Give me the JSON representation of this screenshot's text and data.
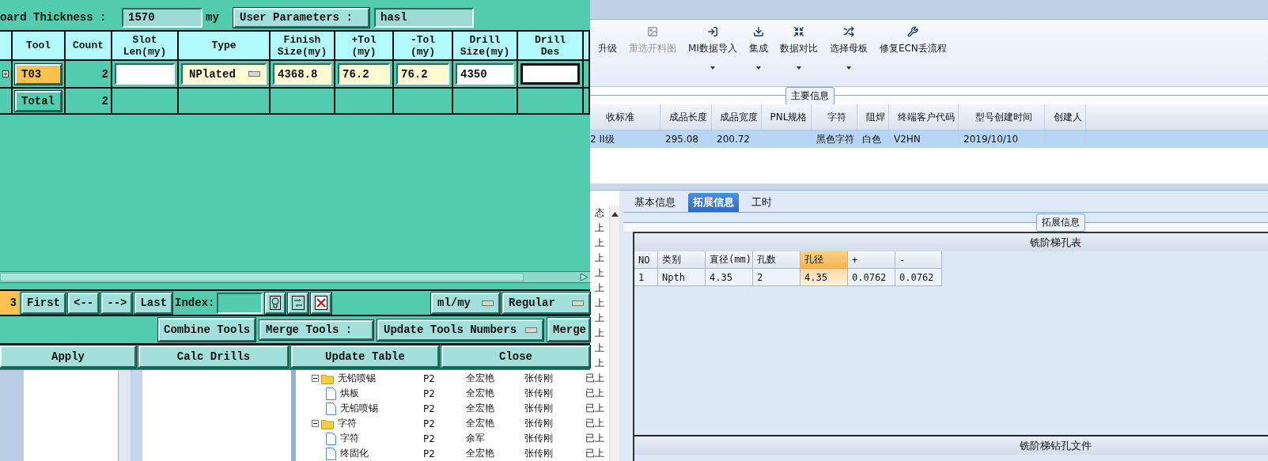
{
  "dialog": {
    "board_thickness": {
      "label": "oard Thickness :",
      "value": "1570",
      "unit": "my"
    },
    "user_parameters": {
      "label": "User Parameters :",
      "value": "hasl"
    },
    "tools_table": {
      "columns": [
        "Tool",
        "Count",
        "Slot Len(my)",
        "Type",
        "Finish Size(my)",
        "+Tol (my)",
        "-Tol (my)",
        "Drill Size(my)",
        "Drill Des"
      ],
      "rows": [
        {
          "tool": "T03",
          "selected": true,
          "count": "2",
          "cells": [
            {
              "kind": "input",
              "highlighted": false,
              "focused": false
            },
            {
              "kind": "dropdown",
              "value": "NPlated",
              "highlighted": true
            },
            {
              "kind": "input",
              "value": "4368.8",
              "highlighted": true,
              "focused": false
            },
            {
              "kind": "input",
              "value": "76.2",
              "highlighted": true,
              "focused": false
            },
            {
              "kind": "input",
              "value": "76.2",
              "highlighted": true,
              "focused": false
            },
            {
              "kind": "input",
              "value": "4350",
              "highlighted": false,
              "focused": false
            },
            {
              "kind": "input",
              "highlighted": false,
              "focused": true
            }
          ]
        },
        {
          "tool": "Total",
          "selected": false,
          "count": "2"
        }
      ]
    },
    "navigation": {
      "current": "3",
      "buttons": [
        "First",
        "<--",
        "-->",
        "Last"
      ],
      "index_label": "Index:",
      "unit_dropdown": "ml/my",
      "mode_dropdown": "Regular"
    },
    "merge": {
      "combine_button": "Combine Tools",
      "label": "Merge Tools :",
      "dropdown": "Update Tools Numbers",
      "merge_button": "Merge"
    },
    "actions": [
      "Apply",
      "Calc Drills",
      "Update Table",
      "Close"
    ]
  },
  "app": {
    "toolbar": [
      {
        "label": "升级",
        "disabled": false,
        "menu": false
      },
      {
        "label": "重选开料图",
        "disabled": true,
        "menu": false
      },
      {
        "label": "MI数据导入",
        "disabled": false,
        "menu": true
      },
      {
        "label": "集成",
        "disabled": false,
        "menu": true
      },
      {
        "label": "数据对比",
        "disabled": false,
        "menu": true
      },
      {
        "label": "选择母板",
        "disabled": false,
        "menu": true
      },
      {
        "label": "修复ECN丢流程",
        "disabled": false,
        "menu": false
      }
    ],
    "main_info": {
      "title": "主要信息",
      "columns": [
        "收标准",
        "成品长度",
        "成品宽度",
        "PNL规格",
        "字符",
        "阻焊",
        "终端客户代码",
        "型号创建时间",
        "创建人"
      ],
      "rows": [
        {
          "selected": true,
          "cells": [
            "2 II级",
            "295.08",
            "200.72",
            null,
            "黑色字符",
            "白色",
            "V2HN",
            "2019/10/10",
            null
          ]
        }
      ]
    },
    "process_tree": {
      "status_header": "态",
      "covered_rows": [
        {
          "status": "上"
        },
        {
          "status": "上"
        },
        {
          "status": "上"
        },
        {
          "status": "上"
        },
        {
          "status": "上"
        },
        {
          "status": "上"
        },
        {
          "status": "上"
        },
        {
          "status": "上"
        },
        {
          "status": "上"
        },
        {
          "status": "上"
        }
      ],
      "nodes": [
        {
          "name": "无铅喷锡",
          "code": "P2",
          "worker": "全宏艳",
          "owner": "张传刚",
          "status": "已上",
          "expanded": true,
          "children": [
            {
              "name": "烘板",
              "code": "P2",
              "worker": "全宏艳",
              "owner": "张传刚",
              "status": "已上"
            },
            {
              "name": "无铅喷锡",
              "code": "P2",
              "worker": "全宏艳",
              "owner": "张传刚",
              "status": "已上"
            }
          ]
        },
        {
          "name": "字符",
          "code": "P2",
          "worker": "全宏艳",
          "owner": "张传刚",
          "status": "已上",
          "expanded": true,
          "children": [
            {
              "name": "字符",
              "code": "P2",
              "worker": "余军",
              "owner": "张传刚",
              "status": "已上"
            },
            {
              "name": "终固化",
              "code": "P2",
              "worker": "全宏艳",
              "owner": "张传刚",
              "status": "已上"
            }
          ]
        }
      ]
    },
    "detail_tabs": [
      {
        "label": "基本信息",
        "selected": false
      },
      {
        "label": "拓展信息",
        "selected": true
      },
      {
        "label": "工时",
        "selected": false
      }
    ],
    "extended_info": {
      "title": "拓展信息",
      "hole_table": {
        "title": "铣阶梯孔表",
        "columns": [
          {
            "label": "NO",
            "selected": false
          },
          {
            "label": "类别",
            "selected": false
          },
          {
            "label": "直径(mm)",
            "selected": false
          },
          {
            "label": "孔数",
            "selected": false
          },
          {
            "label": "孔径",
            "selected": true
          },
          {
            "label": "+",
            "selected": false
          },
          {
            "label": "-",
            "selected": false
          }
        ],
        "rows": [
          [
            "1",
            "Npth",
            "4.35",
            "2",
            "4.35",
            "0.0762",
            "0.0762"
          ]
        ]
      },
      "drill_file": {
        "title": "铣阶梯钻孔文件"
      }
    }
  }
}
